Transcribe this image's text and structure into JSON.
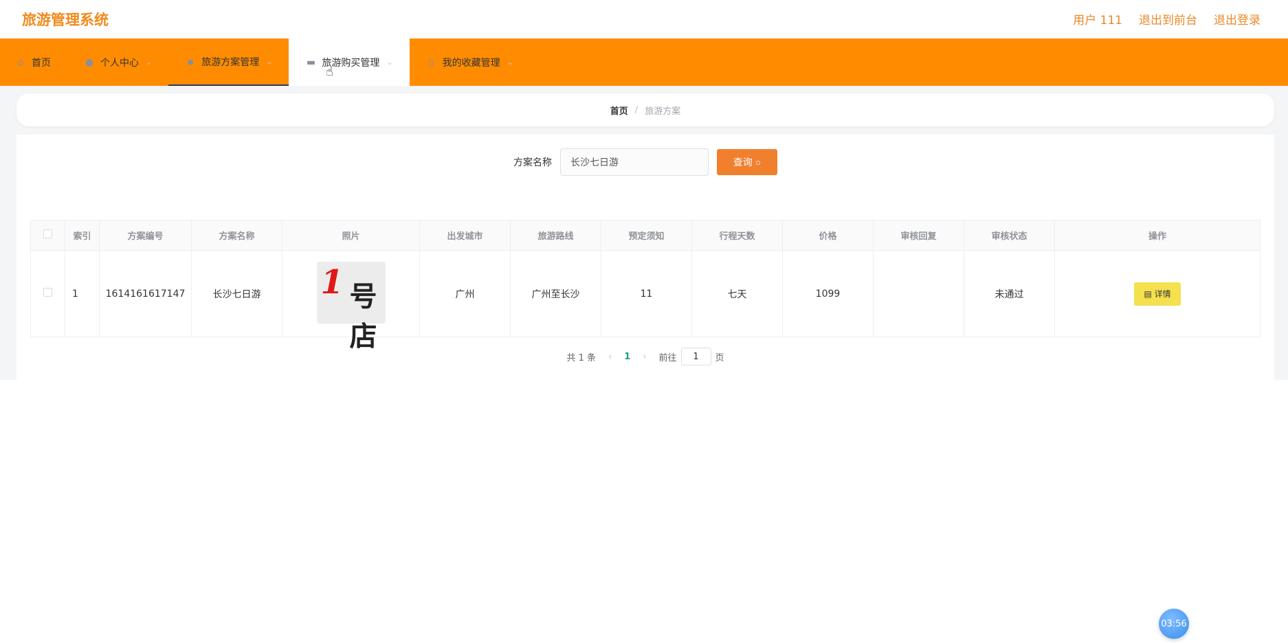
{
  "header": {
    "brand": "旅游管理系统",
    "user": "用户 111",
    "front": "退出到前台",
    "logout": "退出登录"
  },
  "nav": {
    "items": [
      {
        "label": "首页",
        "icon": "home-icon"
      },
      {
        "label": "个人中心",
        "icon": "user-icon"
      },
      {
        "label": "旅游方案管理",
        "icon": "chat-icon"
      },
      {
        "label": "旅游购买管理",
        "icon": "briefcase-icon"
      },
      {
        "label": "我的收藏管理",
        "icon": "bookmark-icon"
      }
    ]
  },
  "breadcrumb": {
    "home": "首页",
    "sep": "/",
    "current": "旅游方案"
  },
  "search": {
    "label": "方案名称",
    "value": "长沙七日游",
    "button": "查询"
  },
  "table": {
    "headers": [
      "索引",
      "方案编号",
      "方案名称",
      "照片",
      "出发城市",
      "旅游路线",
      "预定须知",
      "行程天数",
      "价格",
      "审核回复",
      "审核状态",
      "操作"
    ],
    "rows": [
      {
        "index": "1",
        "code": "1614161617147",
        "name": "长沙七日游",
        "photo_one": "1",
        "photo_txt": "号店",
        "city": "广州",
        "route": "广州至长沙",
        "notice": "11",
        "days": "七天",
        "price": "1099",
        "reply": "",
        "status": "未通过",
        "action": "详情"
      }
    ]
  },
  "pagination": {
    "total": "共 1 条",
    "current": "1",
    "goto_prefix": "前往",
    "goto_value": "1",
    "goto_suffix": "页"
  },
  "timer": "03:56",
  "colors": {
    "accent": "#ff8c00",
    "brand": "#f08a1c",
    "button": "#f0802e",
    "detail": "#f5e04e",
    "page_active": "#16a085"
  }
}
